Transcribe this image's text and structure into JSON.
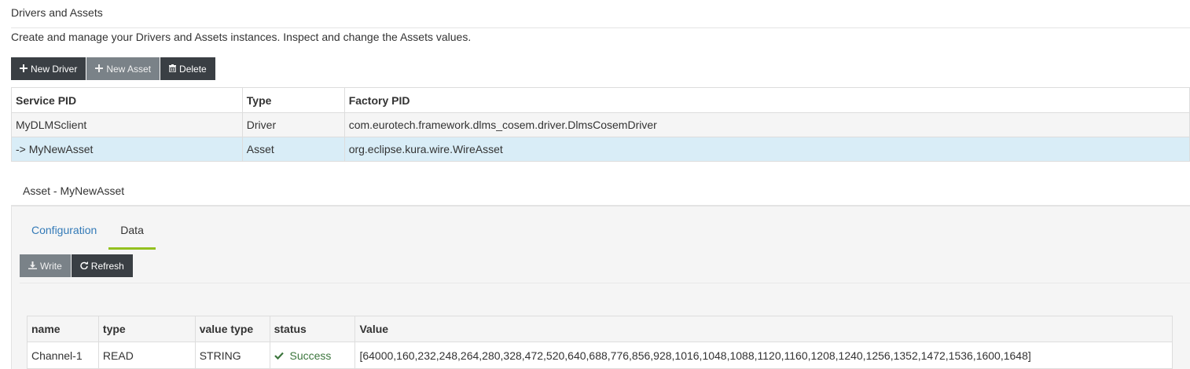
{
  "header": {
    "title": "Drivers and Assets",
    "description": "Create and manage your Drivers and Assets instances. Inspect and change the Assets values."
  },
  "toolbar": {
    "new_driver": "New Driver",
    "new_asset": "New Asset",
    "delete": "Delete"
  },
  "drivers_table": {
    "columns": [
      "Service PID",
      "Type",
      "Factory PID"
    ],
    "rows": [
      {
        "service_pid": "MyDLMSclient",
        "type": "Driver",
        "factory_pid": "com.eurotech.framework.dlms_cosem.driver.DlmsCosemDriver"
      },
      {
        "service_pid": "-> MyNewAsset",
        "type": "Asset",
        "factory_pid": "org.eclipse.kura.wire.WireAsset"
      }
    ]
  },
  "asset": {
    "title": "Asset - MyNewAsset",
    "tabs": [
      "Configuration",
      "Data"
    ],
    "active_tab": "Data",
    "actions": {
      "write": "Write",
      "refresh": "Refresh"
    },
    "channels_table": {
      "columns": [
        "name",
        "type",
        "value type",
        "status",
        "Value"
      ],
      "rows": [
        {
          "name": "Channel-1",
          "type": "READ",
          "value_type": "STRING",
          "status": "Success",
          "value": "[64000,160,232,248,264,280,328,472,520,640,688,776,856,928,1016,1048,1088,1120,1160,1208,1240,1256,1352,1472,1536,1600,1648]"
        }
      ]
    }
  },
  "icons": {
    "plus": "plus-icon",
    "trash": "trash-icon",
    "download": "download-icon",
    "refresh": "refresh-icon",
    "check": "check-icon"
  },
  "colors": {
    "toolbar_dark": "#3a3f44",
    "toolbar_muted": "#7a8288",
    "selected_row": "#d9edf7",
    "tab_link": "#337ab7",
    "tab_active_underline": "#93c01f",
    "success": "#3c763d"
  }
}
